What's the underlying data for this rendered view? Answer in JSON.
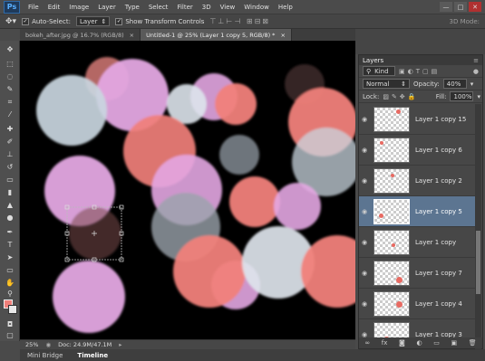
{
  "menu": {
    "logo": "Ps",
    "items": [
      "File",
      "Edit",
      "Image",
      "Layer",
      "Type",
      "Select",
      "Filter",
      "3D",
      "View",
      "Window",
      "Help"
    ],
    "win_min": "—",
    "win_max": "□",
    "win_close": "✕"
  },
  "options": {
    "auto_select_label": "Auto-Select:",
    "auto_select_value": "Layer",
    "show_transform_label": "Show Transform Controls",
    "mode_3d_label": "3D Mode:"
  },
  "doc_tabs": [
    {
      "label": "bokeh_after.jpg @ 16.7% (RGB/8)",
      "close": "×"
    },
    {
      "label": "Untitled-1 @ 25% (Layer 1 copy 5, RGB/8) *",
      "close": "×"
    }
  ],
  "status": {
    "zoom": "25%",
    "doc": "Doc: 24.9M/47.1M"
  },
  "bottom_tabs": [
    "Mini Bridge",
    "Timeline"
  ],
  "layers_panel": {
    "tab_label": "Layers",
    "filter_label": "Kind",
    "blend_mode": "Normal",
    "opacity_label": "Opacity:",
    "opacity_value": "40%",
    "lock_label": "Lock:",
    "fill_label": "Fill:",
    "fill_value": "100%",
    "layers": [
      {
        "name": "Layer 1 copy 15",
        "selected": false
      },
      {
        "name": "Layer 1 copy 6",
        "selected": false
      },
      {
        "name": "Layer 1 copy 2",
        "selected": false
      },
      {
        "name": "Layer 1 copy 5",
        "selected": true
      },
      {
        "name": "Layer 1 copy",
        "selected": false
      },
      {
        "name": "Layer 1 copy 7",
        "selected": false
      },
      {
        "name": "Layer 1 copy 4",
        "selected": false
      },
      {
        "name": "Layer 1 copy 3",
        "selected": false
      }
    ],
    "footer_icons": [
      "link-icon",
      "fx-icon",
      "mask-icon",
      "adjustment-icon",
      "folder-icon",
      "new-layer-icon",
      "trash-icon"
    ]
  },
  "colors": {
    "foreground": "#f07f7a",
    "background": "#e8e8e8",
    "selection": "#5c7591"
  }
}
